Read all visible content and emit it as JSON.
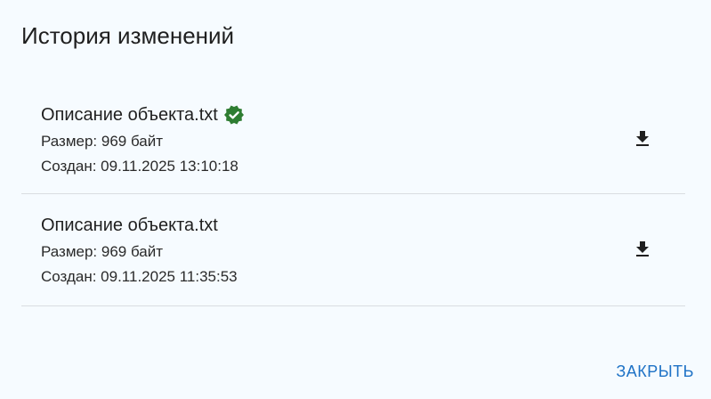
{
  "dialog": {
    "title": "История изменений",
    "close_label": "ЗАКРЫТЬ"
  },
  "versions": [
    {
      "filename": "Описание объекта.txt",
      "size": "Размер: 969 байт",
      "created": "Создан: 09.11.2025 13:10:18",
      "current": true
    },
    {
      "filename": "Описание объекта.txt",
      "size": "Размер: 969 байт",
      "created": "Создан: 09.11.2025 11:35:53",
      "current": false
    }
  ],
  "icons": {
    "verified": "check-decagram-icon",
    "download": "download-icon"
  },
  "colors": {
    "verified": "#2e7d32",
    "accent": "#1e72c6",
    "background": "#f6fbff"
  }
}
